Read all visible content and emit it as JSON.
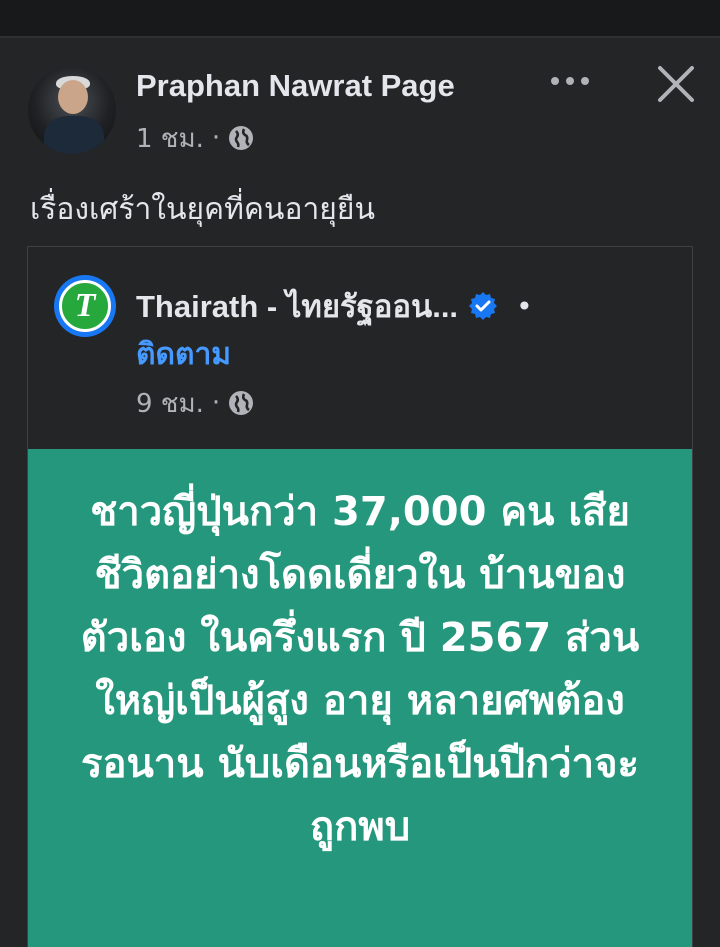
{
  "post": {
    "author": "Praphan Nawrat Page",
    "time": "1 ชม.",
    "separator": "·",
    "text": "เรื่องเศร้าในยุคที่คนอายุยืน",
    "icons": {
      "avatar": "avatar",
      "more": "more-horizontal-icon",
      "close": "close-icon",
      "audience": "globe-icon"
    }
  },
  "shared": {
    "page_name": "Thairath - ไทยรัฐออน...",
    "bullet": "•",
    "follow_label": "ติดตาม",
    "time": "9 ชม.",
    "separator": "·",
    "logo_letter": "T",
    "headline": "ชาวญี่ปุ่นกว่า 37,000 คน เสียชีวิตอย่างโดดเดี่ยวใน บ้านของตัวเอง ในครึ่งแรก ปี 2567 ส่วนใหญ่เป็นผู้สูง อายุ หลายศพต้องรอนาน นับเดือนหรือเป็นปีกว่าจะ ถูกพบ",
    "colors": {
      "card_bg": "#25977c",
      "follow": "#4599ff",
      "verified": "#1877f2",
      "logo_ring": "#1877f2",
      "logo_fill": "#27a83c"
    }
  }
}
